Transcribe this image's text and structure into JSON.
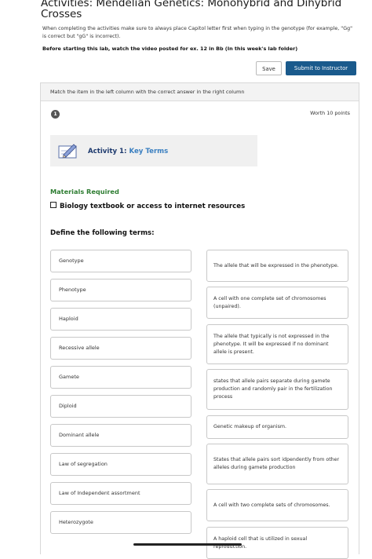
{
  "header": {
    "title": "Activities: Mendelian Genetics: Monohybrid and Dihybrid Crosses",
    "intro": "When completing the activities make sure to always place Capitol letter first when typing in the genotype (for example, \"Gg\" is correct but \"gG\" is incorrect).",
    "intro_bold": "Before starting this lab, watch the video posted for ex. 12 in Bb (In this week's lab folder)"
  },
  "toolbar": {
    "save_label": "Save",
    "submit_label": "Submit to Instructor"
  },
  "question": {
    "instruction": "Match the item in the left column with the correct answer in the right column",
    "number": "1",
    "worth": "Worth 10 points",
    "activity_number": "Activity 1:",
    "activity_name": "Key Terms",
    "materials_heading": "Materials Required",
    "materials_item": "Biology textbook or access to internet resources",
    "define_heading": "Define the following terms:"
  },
  "terms": [
    "Genotype",
    "Phenotype",
    "Haploid",
    "Recessive allele",
    "Gamete",
    "Diploid",
    "Dominant allele",
    "Law of segregation",
    "Law of Independent assortment",
    "Heterozygote"
  ],
  "answers": [
    "The allele that will be expressed in the phenotype.",
    "A cell with one complete set of chromosomes (unpaired).",
    "The allele that typically is not expressed in the phenotype. It will be expressed if no dominant allele is present.",
    "states that allele pairs separate during gamete production and randomly pair in the fertilization process",
    "Genetic makeup of organism.",
    "States that allele pairs sort idpendently from other alleles during gamete production",
    "A cell with two complete sets of chromosomes.",
    "A haploid cell that is utilized in sexual reproduction."
  ],
  "colors": {
    "accent": "#1a5a8c",
    "materials": "#2e7d32",
    "activity": "#3a7fc0"
  }
}
